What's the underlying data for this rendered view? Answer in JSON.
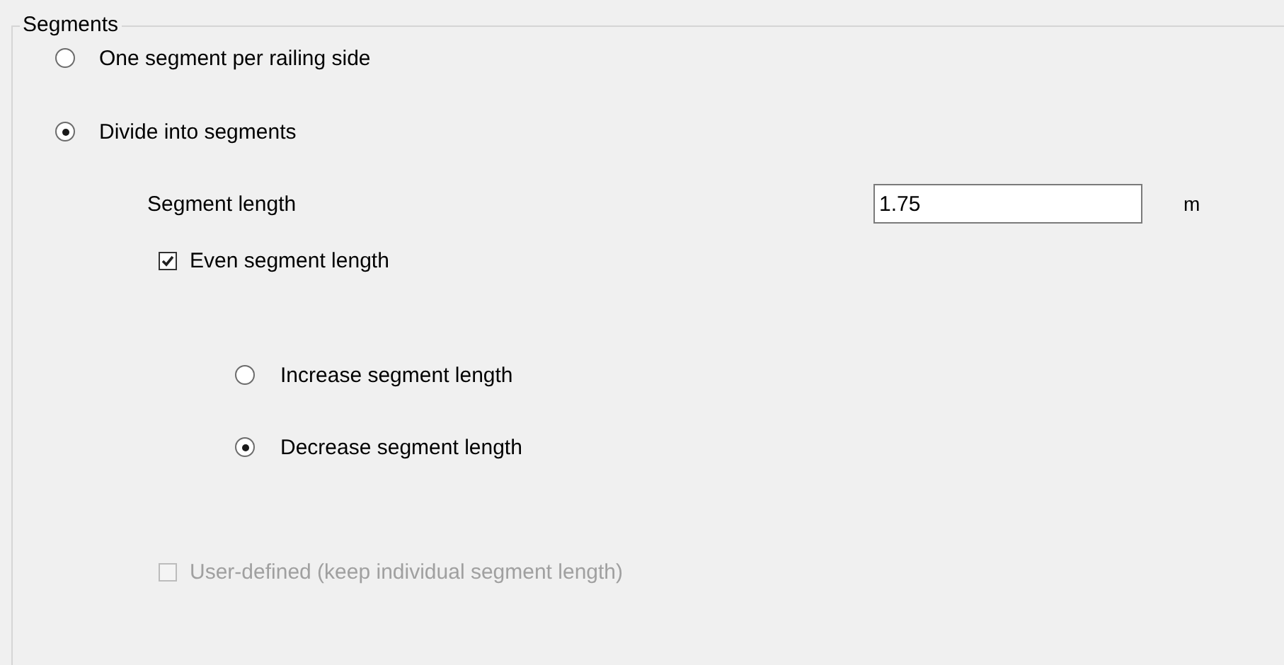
{
  "group": {
    "title": "Segments",
    "options": [
      {
        "label": "One segment per railing side",
        "selected": false
      },
      {
        "label": "Divide into segments",
        "selected": true
      }
    ],
    "segment_length": {
      "label": "Segment length",
      "value": "1.75",
      "unit": "m"
    },
    "even_length": {
      "label": "Even segment length",
      "checked": true,
      "disabled": false
    },
    "even_options": [
      {
        "label": "Increase segment length",
        "selected": false
      },
      {
        "label": "Decrease segment length",
        "selected": true
      }
    ],
    "user_defined": {
      "label": "User-defined (keep individual segment length)",
      "checked": false,
      "disabled": true
    }
  }
}
